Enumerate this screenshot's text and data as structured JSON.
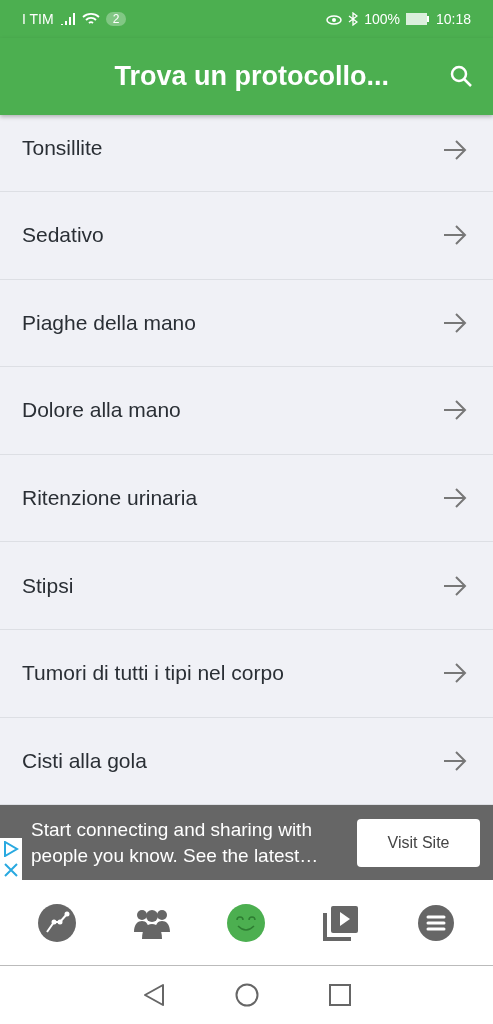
{
  "status_bar": {
    "carrier": "I TIM",
    "notifications": "2",
    "battery": "100%",
    "time": "10:18"
  },
  "app_bar": {
    "title": "Trova un protocollo..."
  },
  "protocols": [
    {
      "label": "Tonsillite"
    },
    {
      "label": "Sedativo"
    },
    {
      "label": "Piaghe della mano"
    },
    {
      "label": "Dolore alla mano"
    },
    {
      "label": "Ritenzione urinaria"
    },
    {
      "label": "Stipsi"
    },
    {
      "label": "Tumori di tutti i tipi nel corpo"
    },
    {
      "label": "Cisti alla gola"
    }
  ],
  "ad": {
    "text": "Start connecting and sharing with people you know. See the latest…",
    "button": "Visit Site"
  },
  "bottom_nav": [
    {
      "kind": "chart",
      "selected": false
    },
    {
      "kind": "people",
      "selected": false
    },
    {
      "kind": "smile",
      "selected": true
    },
    {
      "kind": "video",
      "selected": false
    },
    {
      "kind": "menu",
      "selected": false
    }
  ]
}
